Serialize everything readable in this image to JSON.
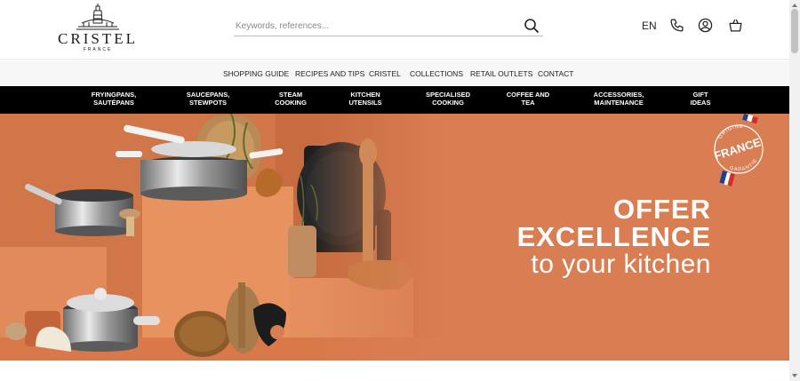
{
  "header": {
    "logo_text": "CRISTEL",
    "logo_subtext": "FRANCE",
    "search_placeholder": "Keywords, references...",
    "language": "EN",
    "icons": [
      "search-icon",
      "phone-icon",
      "account-icon",
      "basket-icon"
    ]
  },
  "main_menu": {
    "items": [
      "SHOPPING GUIDE",
      "RECIPES AND TIPS",
      "CRISTEL",
      "COLLECTIONS",
      "RETAIL OUTLETS",
      "CONTACT"
    ]
  },
  "category_menu": {
    "items": [
      {
        "line1": "FRYINGPANS,",
        "line2": "SAUTÉPANS"
      },
      {
        "line1": "SAUCEPANS,",
        "line2": "STEWPOTS"
      },
      {
        "line1": "STEAM",
        "line2": "COOKING"
      },
      {
        "line1": "KITCHEN",
        "line2": "UTENSILS"
      },
      {
        "line1": "SPECIALISED",
        "line2": "COOKING"
      },
      {
        "line1": "COFFEE AND",
        "line2": "TEA"
      },
      {
        "line1": "ACCESSORIES,",
        "line2": "MAINTENANCE"
      },
      {
        "line1": "GIFT",
        "line2": "IDEAS"
      }
    ]
  },
  "hero": {
    "line1": "OFFER",
    "line2": "EXCELLENCE",
    "line3": "to your kitchen",
    "badge": {
      "top": "ORIGINE",
      "center": "FRANCE",
      "bottom": "GARANTIE"
    }
  },
  "colors": {
    "hero_bg": "#d97e53",
    "category_bar": "#000000",
    "main_menu_bg": "#f7f7f7",
    "flag_blue": "#1f3f8f",
    "flag_red": "#d62b2b"
  }
}
